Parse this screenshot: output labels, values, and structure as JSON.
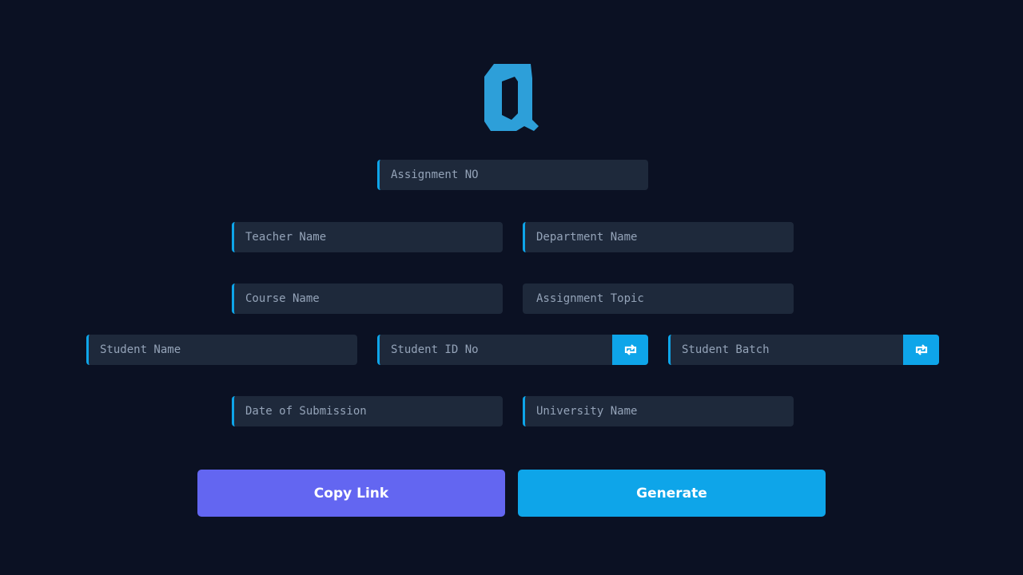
{
  "colors": {
    "background": "#0b1123",
    "field_bg": "#1e293b",
    "accent": "#0ea5e9",
    "copy_button": "#6366f1",
    "placeholder": "#94a3b8"
  },
  "logo": {
    "icon": "alpha-logo-icon"
  },
  "fields": {
    "assignment_no": {
      "placeholder": "Assignment NO",
      "value": ""
    },
    "teacher_name": {
      "placeholder": "Teacher Name",
      "value": ""
    },
    "department_name": {
      "placeholder": "Department Name",
      "value": ""
    },
    "course_name": {
      "placeholder": "Course Name",
      "value": ""
    },
    "assignment_topic": {
      "placeholder": "Assignment Topic",
      "value": ""
    },
    "student_name": {
      "placeholder": "Student Name",
      "value": ""
    },
    "student_id": {
      "placeholder": "Student ID No",
      "value": ""
    },
    "student_batch": {
      "placeholder": "Student Batch",
      "value": ""
    },
    "date_of_submission": {
      "placeholder": "Date of Submission",
      "value": ""
    },
    "university_name": {
      "placeholder": "University Name",
      "value": ""
    }
  },
  "icons": {
    "swap": "swap-arrows-icon"
  },
  "buttons": {
    "copy_link": "Copy Link",
    "generate": "Generate"
  }
}
